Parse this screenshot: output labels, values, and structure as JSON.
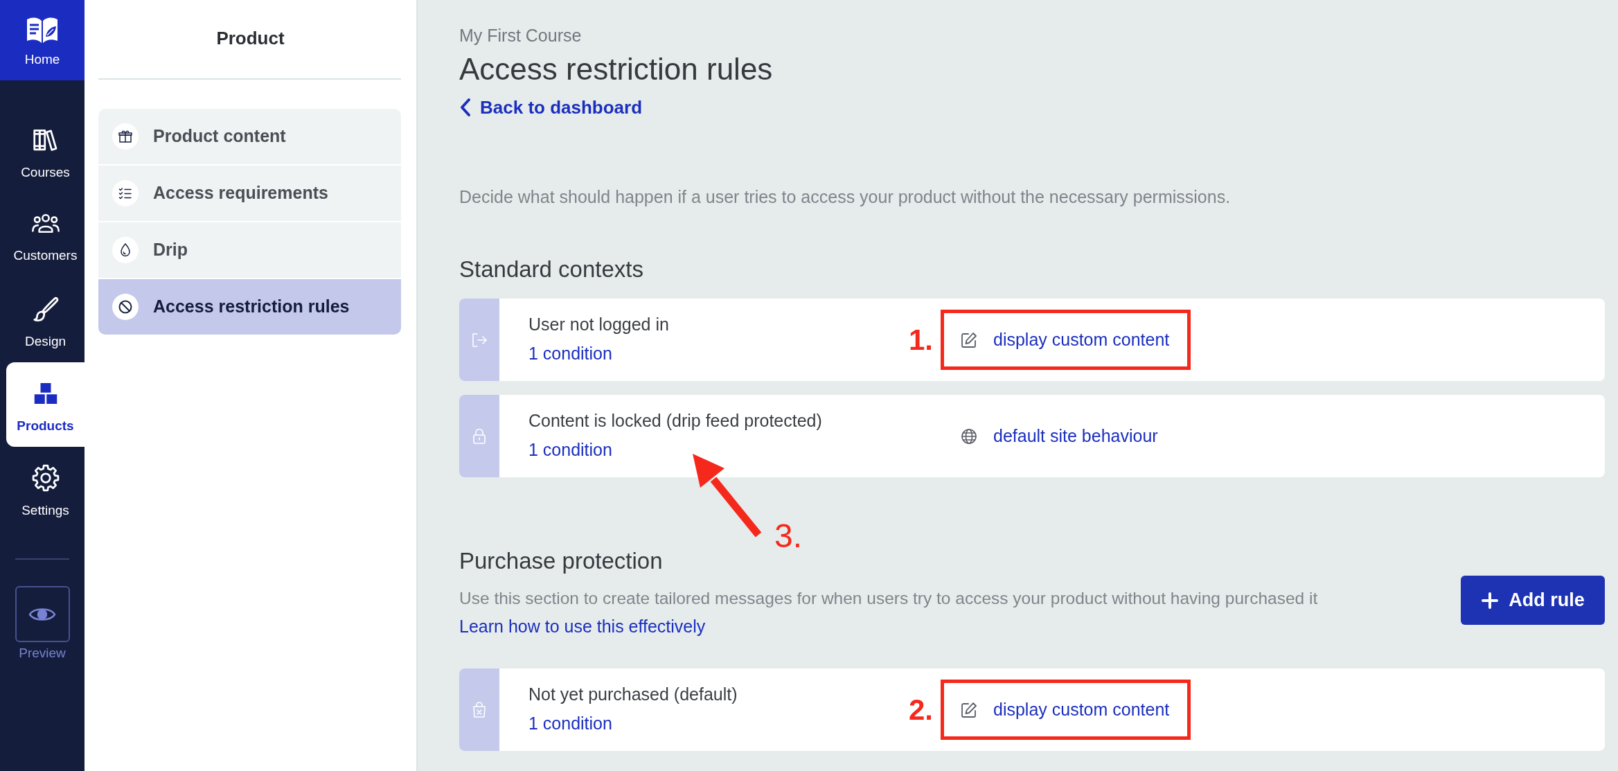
{
  "rail": {
    "home": {
      "label": "Home"
    },
    "items": [
      {
        "label": "Courses",
        "selected": false
      },
      {
        "label": "Customers",
        "selected": false
      },
      {
        "label": "Design",
        "selected": false
      },
      {
        "label": "Products",
        "selected": true
      },
      {
        "label": "Settings",
        "selected": false
      }
    ],
    "preview": {
      "label": "Preview"
    }
  },
  "sidebar": {
    "title": "Product",
    "items": [
      {
        "label": "Product content",
        "selected": false
      },
      {
        "label": "Access requirements",
        "selected": false
      },
      {
        "label": "Drip",
        "selected": false
      },
      {
        "label": "Access restriction rules",
        "selected": true
      }
    ]
  },
  "header": {
    "breadcrumb": "My First Course",
    "title": "Access restriction rules",
    "back_link": "Back to dashboard",
    "description": "Decide what should happen if a user tries to access your product without the necessary permissions."
  },
  "standard_contexts": {
    "heading": "Standard contexts",
    "rules": [
      {
        "name": "User not logged in",
        "conditions": "1 condition",
        "action": {
          "kind": "custom",
          "label": "display custom content"
        },
        "annotation": {
          "kind": "box",
          "label": "1."
        }
      },
      {
        "name": "Content is locked (drip feed protected)",
        "conditions": "1 condition",
        "action": {
          "kind": "default",
          "label": "default site behaviour"
        },
        "annotation": {
          "kind": "arrow",
          "label": "3."
        }
      }
    ]
  },
  "purchase_protection": {
    "heading": "Purchase protection",
    "description": "Use this section to create tailored messages for when users try to access your product without having purchased it",
    "learn_link": "Learn how to use this effectively",
    "add_button": "Add rule",
    "rules": [
      {
        "name": "Not yet purchased (default)",
        "conditions": "1 condition",
        "action": {
          "kind": "custom",
          "label": "display custom content"
        },
        "annotation": {
          "kind": "box",
          "label": "2."
        }
      }
    ]
  }
}
